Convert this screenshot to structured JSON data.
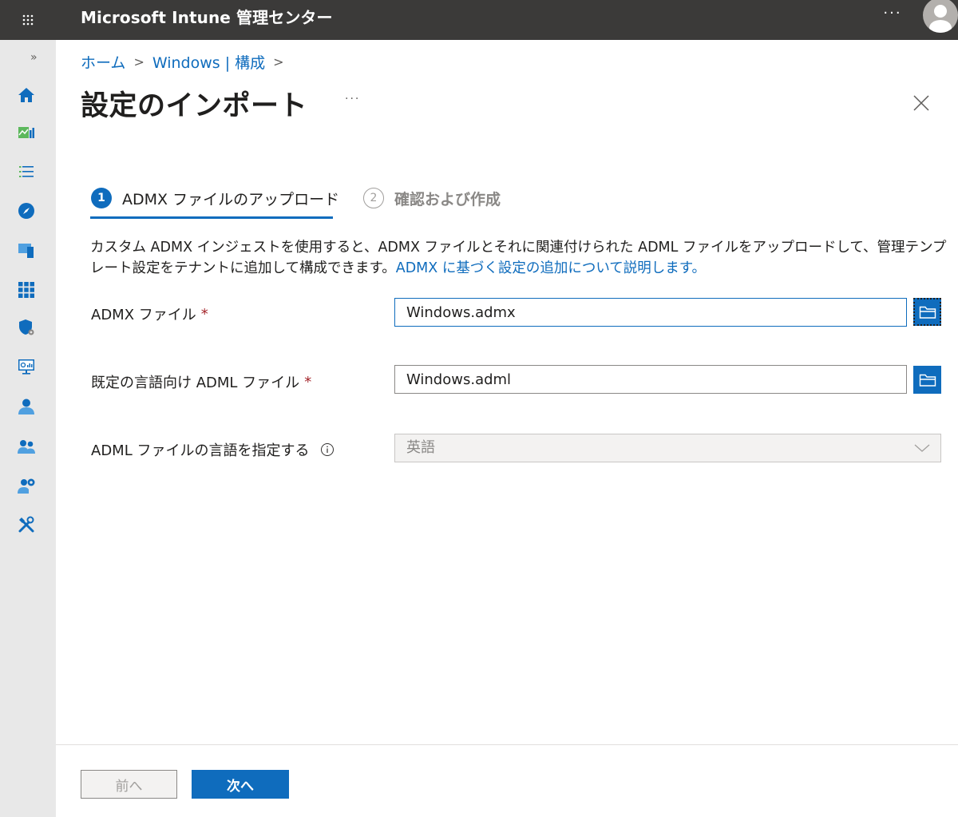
{
  "topbar": {
    "app_title": "Microsoft Intune 管理センター",
    "more_label": "···",
    "icons": [
      "waffle-menu-icon",
      "user-avatar-icon"
    ]
  },
  "rail": {
    "expand_label": "»",
    "items": [
      {
        "icon": "home-icon"
      },
      {
        "icon": "dashboard-icon"
      },
      {
        "icon": "all-services-icon"
      },
      {
        "icon": "explore-icon"
      },
      {
        "icon": "devices-icon"
      },
      {
        "icon": "apps-icon"
      },
      {
        "icon": "endpoint-security-icon"
      },
      {
        "icon": "reports-icon"
      },
      {
        "icon": "users-icon"
      },
      {
        "icon": "groups-icon"
      },
      {
        "icon": "tenant-admin-icon"
      },
      {
        "icon": "troubleshooting-icon"
      }
    ]
  },
  "breadcrumb": {
    "items": [
      "ホーム",
      "Windows | 構成"
    ],
    "separator": ">"
  },
  "page": {
    "title": "設定のインポート",
    "more_label": "···"
  },
  "steps": [
    {
      "number": "1",
      "label": "ADMX ファイルのアップロード",
      "active": true
    },
    {
      "number": "2",
      "label": "確認および作成",
      "active": false
    }
  ],
  "description": {
    "text": "カスタム ADMX インジェストを使用すると、ADMX ファイルとそれに関連付けられた ADML ファイルをアップロードして、管理テンプレート設定をテナントに追加して構成できます。",
    "link": "ADMX に基づく設定の追加について説明します。"
  },
  "form": {
    "admx": {
      "label": "ADMX ファイル",
      "required": "*",
      "value": "Windows.admx"
    },
    "adml": {
      "label": "既定の言語向け ADML ファイル",
      "required": "*",
      "value": "Windows.adml"
    },
    "language": {
      "label": "ADML ファイルの言語を指定する",
      "value": "英語",
      "disabled": true
    }
  },
  "footer": {
    "prev_label": "前へ",
    "next_label": "次へ"
  },
  "colors": {
    "accent": "#0f6cbd",
    "topbar": "#3b3a39",
    "rail": "#e8e8e8",
    "required": "#a4262c"
  }
}
